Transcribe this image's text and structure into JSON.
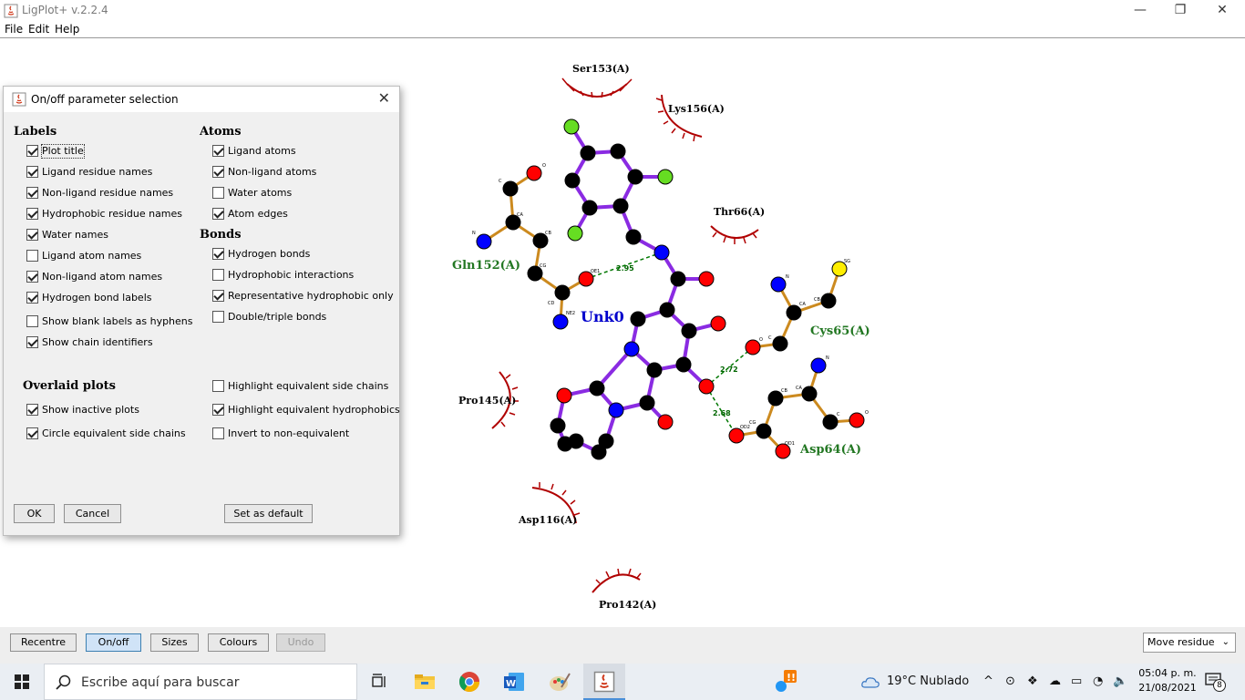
{
  "window": {
    "title": "LigPlot+ v.2.2.4"
  },
  "menu": [
    "File",
    "Edit",
    "Help"
  ],
  "plot": {
    "ligand_name": "Unk0",
    "residues_interacting": [
      "Gln152(A)",
      "Cys65(A)",
      "Asp64(A)"
    ],
    "residues_hydrophobic": [
      "Ser153(A)",
      "Lys156(A)",
      "Thr66(A)",
      "Pro145(A)",
      "Asp116(A)",
      "Pro142(A)"
    ],
    "hbond_distances": [
      "2.95",
      "2.72",
      "2.68"
    ],
    "atom_labels": {
      "gln_o": "O",
      "gln_c": "C",
      "gln_ca": "CA",
      "gln_n": "N",
      "gln_cb": "CB",
      "gln_cg": "CG",
      "gln_cd": "CD",
      "gln_oe1": "OE1",
      "gln_ne2": "NE2",
      "cys_n": "N",
      "cys_ca": "CA",
      "cys_cb": "CB",
      "cys_sg": "SG",
      "cys_c": "C",
      "cys_o": "O",
      "asp_n": "N",
      "asp_ca": "CA",
      "asp_cb": "CB",
      "asp_cg": "CG",
      "asp_od1": "OD1",
      "asp_od2": "OD2",
      "asp_c": "C",
      "asp_o": "O"
    },
    "colors": {
      "ligand_bond": "#8a2be2",
      "residue_bond": "#cc8a1f",
      "carbon": "#000000",
      "oxygen": "#ff0000",
      "nitrogen": "#0000ff",
      "halogen": "#66dd22",
      "sulfur": "#ffee00",
      "hbond": "#007700",
      "hydrophobic": "#b00000",
      "residue_label": "#227722",
      "ligand_label": "#0000cc"
    }
  },
  "toolbar": {
    "recentre": "Recentre",
    "onoff": "On/off",
    "sizes": "Sizes",
    "colours": "Colours",
    "undo": "Undo",
    "mode_select": "Move residue"
  },
  "dialog": {
    "title": "On/off parameter selection",
    "labels_heading": "Labels",
    "atoms_heading": "Atoms",
    "bonds_heading": "Bonds",
    "overlaid_heading": "Overlaid plots",
    "labels": [
      {
        "label": "Plot title",
        "checked": true
      },
      {
        "label": "Ligand residue names",
        "checked": true
      },
      {
        "label": "Non-ligand residue names",
        "checked": true
      },
      {
        "label": "Hydrophobic residue names",
        "checked": true
      },
      {
        "label": "Water names",
        "checked": true
      },
      {
        "label": "Ligand atom names",
        "checked": false
      },
      {
        "label": "Non-ligand atom names",
        "checked": true
      },
      {
        "label": "Hydrogen bond labels",
        "checked": true
      },
      {
        "label": "Show blank labels as hyphens",
        "checked": false
      },
      {
        "label": "Show chain identifiers",
        "checked": true
      }
    ],
    "atoms": [
      {
        "label": "Ligand atoms",
        "checked": true
      },
      {
        "label": "Non-ligand atoms",
        "checked": true
      },
      {
        "label": "Water atoms",
        "checked": false
      },
      {
        "label": "Atom edges",
        "checked": true
      }
    ],
    "bonds": [
      {
        "label": "Hydrogen bonds",
        "checked": true
      },
      {
        "label": "Hydrophobic interactions",
        "checked": false
      },
      {
        "label": "Representative hydrophobic only",
        "checked": true
      },
      {
        "label": "Double/triple bonds",
        "checked": false
      }
    ],
    "overlaid_left": [
      {
        "label": "Show inactive plots",
        "checked": true
      },
      {
        "label": "Circle equivalent side chains",
        "checked": true
      }
    ],
    "overlaid_right": [
      {
        "label": "Highlight equivalent side chains",
        "checked": false
      },
      {
        "label": "Highlight equivalent hydrophobics",
        "checked": true
      },
      {
        "label": "Invert to non-equivalent",
        "checked": false
      }
    ],
    "ok": "OK",
    "cancel": "Cancel",
    "set_default": "Set as default"
  },
  "taskbar": {
    "search_placeholder": "Escribe aquí para buscar",
    "weather": "19°C  Nublado",
    "time": "05:04 p. m.",
    "date": "21/08/2021",
    "notifications": "8"
  }
}
